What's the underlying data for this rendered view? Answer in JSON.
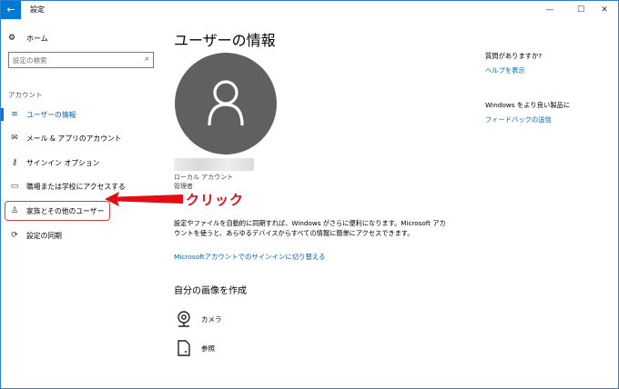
{
  "window": {
    "title": "設定",
    "back_icon": "arrow-left-icon",
    "min_glyph": "—",
    "max_glyph": "☐",
    "close_glyph": "✕"
  },
  "sidebar": {
    "home": {
      "label": "ホーム",
      "icon": "gear-icon"
    },
    "search": {
      "placeholder": "設定の検索",
      "value": ""
    },
    "section": "アカウント",
    "items": [
      {
        "label": "ユーザーの情報",
        "icon": "person-card-icon",
        "active": true
      },
      {
        "label": "メール & アプリのアカウント",
        "icon": "mail-icon",
        "active": false
      },
      {
        "label": "サインイン オプション",
        "icon": "key-icon",
        "active": false
      },
      {
        "label": "職場または学校にアクセスする",
        "icon": "briefcase-icon",
        "active": false
      },
      {
        "label": "家族とその他のユーザー",
        "icon": "person-add-icon",
        "active": false
      },
      {
        "label": "設定の同期",
        "icon": "sync-icon",
        "active": false
      }
    ]
  },
  "callout": {
    "text": "クリック",
    "color": "#e30d16"
  },
  "main": {
    "title": "ユーザーの情報",
    "account_type": "ローカル アカウント",
    "role": "管理者",
    "description": "設定やファイルを自動的に同期すれば、Windows がさらに便利になります。Microsoft アカウントを使うと、あらゆるデバイスからすべての情報に簡単にアクセスできます。",
    "ms_link": "Microsoftアカウントでのサインインに切り替える",
    "picture_heading": "自分の画像を作成",
    "options": [
      {
        "label": "カメラ",
        "icon": "webcam-icon"
      },
      {
        "label": "参照",
        "icon": "file-browse-icon"
      }
    ]
  },
  "help": {
    "question": "質問がありますか?",
    "help_link": "ヘルプを表示",
    "improve": "Windows をより良い製品に",
    "feedback_link": "フィードバックの送信"
  },
  "colors": {
    "accent": "#0078d7",
    "link": "#0063b1",
    "highlight": "#e33b3b"
  }
}
